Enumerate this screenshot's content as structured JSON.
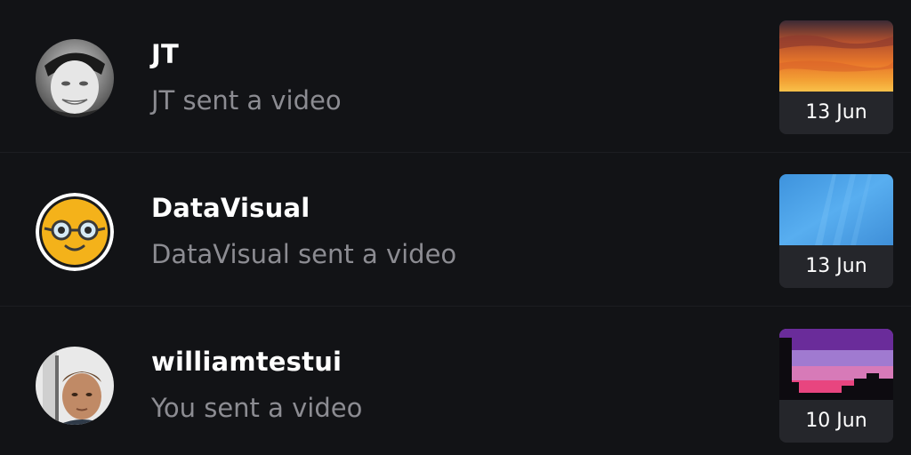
{
  "conversations": [
    {
      "name": "JT",
      "subtitle": "JT sent a video",
      "date": "13 Jun",
      "avatar_icon": "user-photo-jt",
      "thumb_icon": "sunset-video-thumbnail"
    },
    {
      "name": "DataVisual",
      "subtitle": "DataVisual sent a video",
      "date": "13 Jun",
      "avatar_icon": "nerd-face-icon",
      "thumb_icon": "blue-sky-video-thumbnail"
    },
    {
      "name": "williamtestui",
      "subtitle": "You sent a video",
      "date": "10 Jun",
      "avatar_icon": "user-photo-williamtestui",
      "thumb_icon": "purple-skyline-video-thumbnail"
    }
  ],
  "colors": {
    "background": "#121316",
    "name_text": "#ffffff",
    "subtitle_text": "#8c8c92",
    "date_panel": "#25262b",
    "emoji_yellow": "#f4b21a"
  }
}
